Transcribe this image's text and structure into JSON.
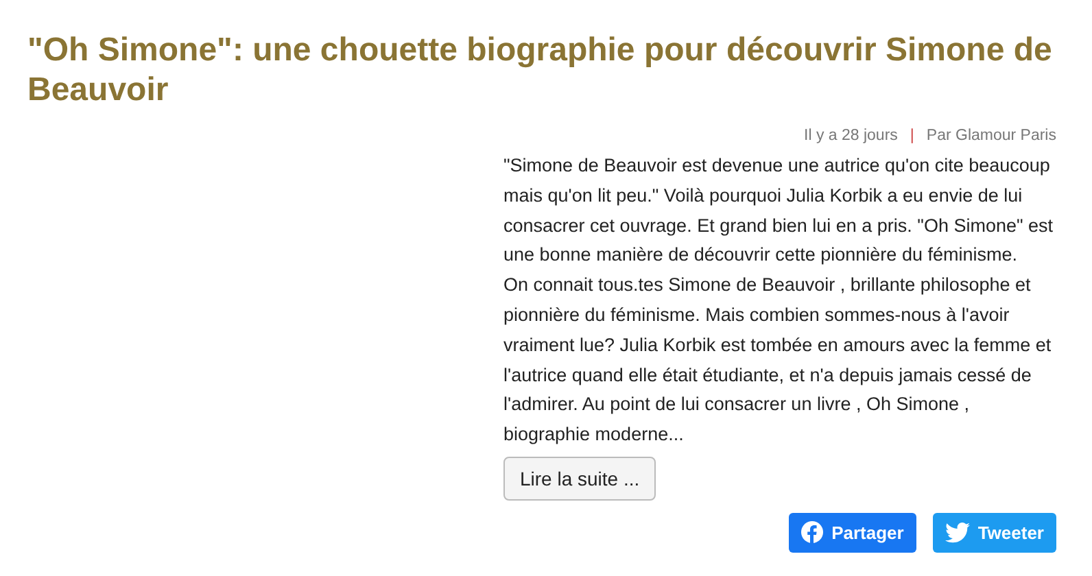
{
  "title": "\"Oh Simone\": une chouette biographie pour découvrir Simone de Beauvoir",
  "meta": {
    "date": "Il y a 28 jours",
    "separator": "|",
    "author": "Par Glamour Paris"
  },
  "paragraphs": [
    "\"Simone de Beauvoir est devenue une autrice qu'on cite beaucoup mais qu'on lit peu.\" Voilà pourquoi Julia Korbik a eu envie de lui consacrer cet ouvrage. Et grand bien lui en a pris. \"Oh Simone\" est une bonne manière de découvrir cette pionnière du féminisme.",
    "On connait tous.tes Simone de Beauvoir , brillante philosophe et pionnière du féminisme. Mais combien sommes-nous à l'avoir vraiment lue? Julia Korbik est tombée en amours avec la femme et l'autrice quand elle était étudiante, et n'a depuis jamais cessé de l'admirer. Au point de lui consacrer un livre , Oh Simone , biographie moderne..."
  ],
  "read_more": "Lire la suite ...",
  "share_buttons": [
    {
      "kind": "facebook",
      "label": "Partager"
    },
    {
      "kind": "twitter",
      "label": "Tweeter"
    }
  ]
}
